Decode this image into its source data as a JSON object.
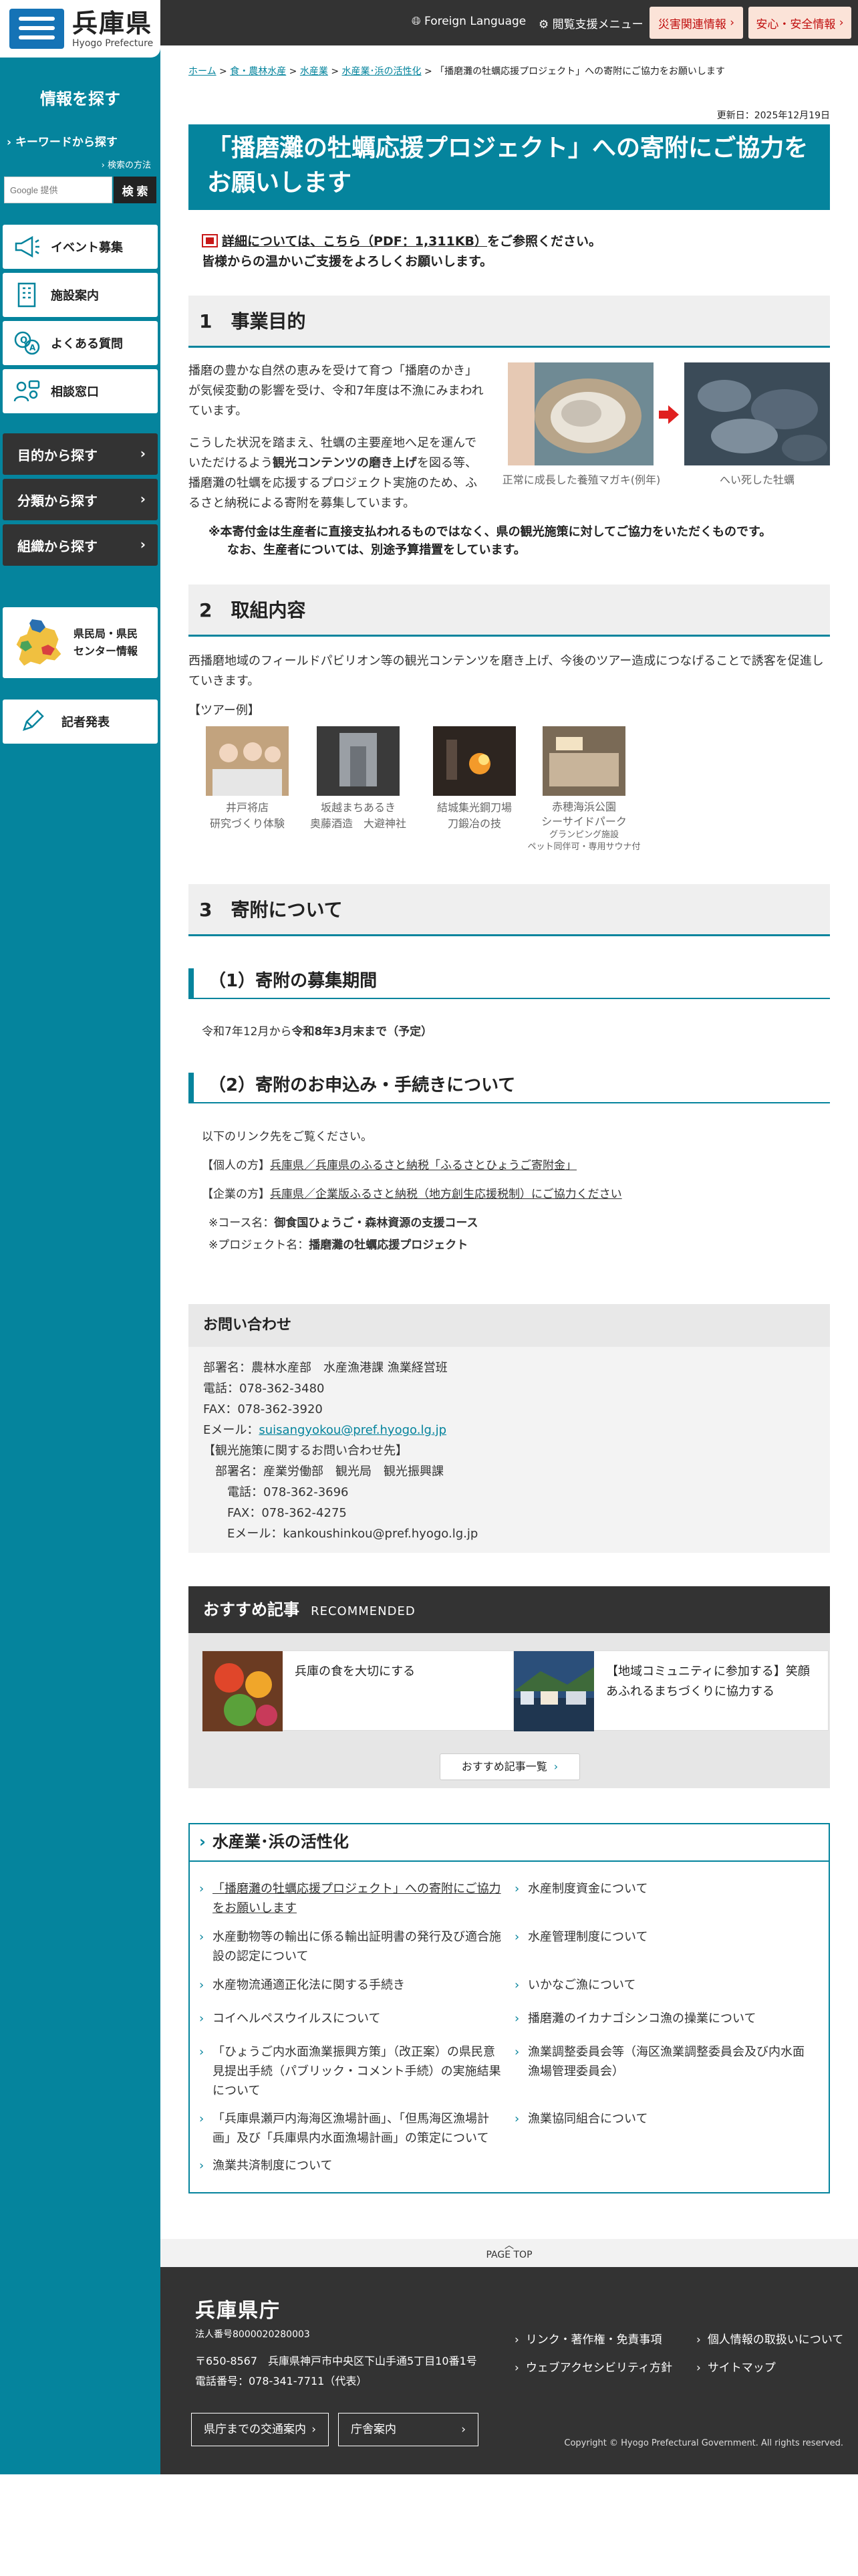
{
  "site": {
    "name_ja": "兵庫県",
    "name_en": "Hyogo Prefecture"
  },
  "header": {
    "foreign_language": "Foreign Language",
    "accessibility_menu": "閲覧支援メニュー",
    "disaster_info": "災害関連情報",
    "safety_info": "安心・安全情報"
  },
  "sidebar": {
    "search_title": "情報を探す",
    "keyword_label": "キーワードから探す",
    "search_howto": "検索の方法",
    "search_placeholder": "Google 提供",
    "search_button": "検 索",
    "links": [
      "イベント募集",
      "施設案内",
      "よくある質問",
      "相談窓口"
    ],
    "browse": [
      "目的から探す",
      "分類から探す",
      "組織から探す"
    ],
    "center_info_line1": "県民局・県民",
    "center_info_line2": "センター情報",
    "press": "記者発表"
  },
  "breadcrumb": {
    "items": [
      "ホーム",
      "食・農林水産",
      "水産業",
      "水産業･浜の活性化"
    ],
    "current": "「播磨灘の牡蠣応援プロジェクト」への寄附にご協力をお願いします"
  },
  "updated": "更新日：2025年12月19日",
  "title": "「播磨灘の牡蠣応援プロジェクト」への寄附にご協力をお願いします",
  "notice": {
    "pdf_link": "詳細については、こちら（PDF：1,311KB）",
    "after": "をご参照ください。",
    "line2": "皆様からの温かいご支援をよろしくお願いします。"
  },
  "sec1": {
    "heading": "1　事業目的",
    "p1": [
      "播磨の豊かな自然の恵みを受けて育つ「播磨のかき」",
      "が気候変動の影響を受け、令和7年度は不漁にみまわれ",
      "ています。"
    ],
    "p2_a": "こうした状況を踏まえ、牡蠣の主要産地へ足を運んで",
    "p2_b_pre": "いただけるよう",
    "p2_b_bold": "観光コンテンツの磨き上げ",
    "p2_b_post": "を図る等、",
    "p2_c": "播磨灘の牡蠣を応援するプロジェクト実施のため、ふ",
    "p2_d": "るさと納税による寄附を募集しています。",
    "note1": "※本寄付金は生産者に直接支払われるものではなく、県の観光施策に対してご協力をいただくものです。",
    "note2": "なお、生産者については、別途予算措置をしています。",
    "cap1": "正常に成長した養殖マガキ(例年)",
    "cap2": "へい死した牡蠣"
  },
  "sec2": {
    "heading": "2　取組内容",
    "p": [
      "西播磨地域のフィールドパビリオン等の観光コンテンツを磨き上げ、今後のツアー造成につなげることで誘客を促進し",
      "ていきます。"
    ],
    "tour_label": "【ツアー例】",
    "tours": [
      {
        "l1": "井戸将店",
        "l2": "研究づくり体験"
      },
      {
        "l1": "坂越まちあるき",
        "l2": "奥藤酒造　大避神社"
      },
      {
        "l1": "結城集光鋼刀場",
        "l2": "刀鍛冶の技"
      },
      {
        "l1": "赤穂海浜公園",
        "l2": "シーサイドパーク",
        "l3": "グランピング施設",
        "l4": "ペット同伴可・専用サウナ付"
      }
    ]
  },
  "sec3": {
    "heading": "3　寄附について",
    "h3a": "（1）寄附の募集期間",
    "period_pre": "令和7年12月から",
    "period_bold": "令和8年3月末まで（予定）",
    "h3b": "（2）寄附のお申込み・手続きについて",
    "intro": "以下のリンク先をご覧ください。",
    "individual_label": "【個人の方】",
    "individual_link": "兵庫県／兵庫県のふるさと納税「ふるさとひょうご寄附金」",
    "corporate_label": "【企業の方】",
    "corporate_link": "兵庫県／企業版ふるさと納税（地方創生応援税制）にご協力ください",
    "course_label": "※コース名：",
    "course": "御食国ひょうご・森林資源の支援コース",
    "project_label": "※プロジェクト名：",
    "project": "播磨灘の牡蠣応援プロジェクト"
  },
  "contact": {
    "heading": "お問い合わせ",
    "lines": [
      "部署名：農林水産部　水産漁港課 漁業経営班",
      "電話：078-362-3480",
      "FAX：078-362-3920"
    ],
    "email_label": "Eメール：",
    "email": "suisangyokou@pref.hyogo.lg.jp",
    "tourism": [
      "【観光施策に関するお問い合わせ先】",
      "部署名：産業労働部　観光局　観光振興課",
      "電話：078-362-3696",
      "FAX：078-362-4275",
      "Eメール：kankoushinkou@pref.hyogo.lg.jp"
    ]
  },
  "recommended": {
    "heading": "おすすめ記事",
    "heading_en": "RECOMMENDED",
    "items": [
      "兵庫の食を大切にする",
      "【地域コミュニティに参加する】笑顔あふれるまちづくりに協力する"
    ],
    "more": "おすすめ記事一覧"
  },
  "related": {
    "heading": "水産業･浜の活性化",
    "left": [
      "「播磨灘の牡蠣応援プロジェクト」への寄附にご協力をお願いします",
      "水産動物等の輸出に係る輸出証明書の発行及び適合施設の認定について",
      "水産物流通適正化法に関する手続き",
      "コイヘルペスウイルスについて",
      "「ひょうご内水面漁業振興方策」（改正案）の県民意見提出手続（パブリック・コメント手続）の実施結果について",
      "「兵庫県瀬戸内海海区漁場計画」、「但馬海区漁場計画」及び「兵庫県内水面漁場計画」の策定について",
      "漁業共済制度について"
    ],
    "right": [
      "水産制度資金について",
      "水産管理制度について",
      "いかなご漁について",
      "播磨灘のイカナゴシンコ漁の操業について",
      "漁業調整委員会等（海区漁業調整委員会及び内水面漁場管理委員会）",
      "漁業協同組合について"
    ]
  },
  "footer": {
    "page_top": "PAGE TOP",
    "name": "兵庫県庁",
    "corp_no": "法人番号8000020280003",
    "address": "〒650-8567　兵庫県神戸市中央区下山手通5丁目10番1号",
    "phone": "電話番号：078-341-7711（代表）",
    "links": [
      "リンク・著作権・免責事項",
      "個人情報の取扱いについて",
      "ウェブアクセシビリティ方針",
      "サイトマップ"
    ],
    "btn_access": "県庁までの交通案内",
    "btn_guide": "庁舎案内",
    "copyright": "Copyright © Hyogo Prefectural Government. All rights reserved."
  }
}
